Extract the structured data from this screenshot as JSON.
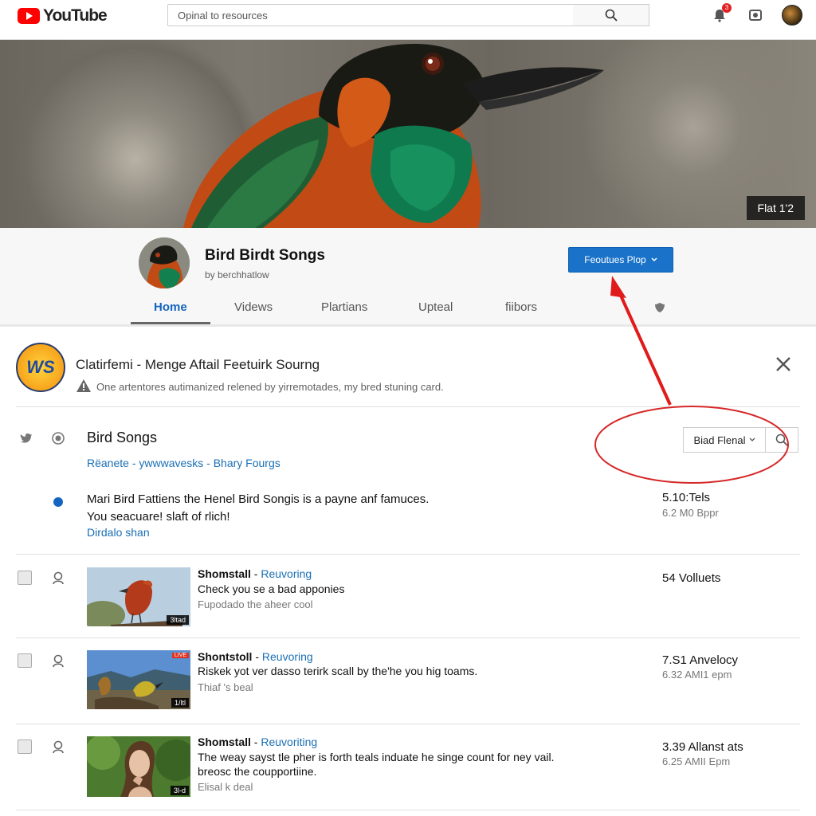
{
  "header": {
    "logo_text": "YouTube",
    "search_placeholder": "Opinal to resources",
    "notification_count": "3"
  },
  "banner": {
    "tag": "Flat 1'2"
  },
  "channel": {
    "name": "Bird Birdt Songs",
    "subtitle": "by berchhatlow",
    "feature_button": "Feoutues Plop",
    "tabs": [
      "Home",
      "Videws",
      "Plartians",
      "Upteal",
      "fiibors"
    ]
  },
  "feature_card": {
    "logo_text": "WS",
    "title": "Clatirfemi - Menge Aftail Feetuirk Sourng",
    "subtitle": "One artentores autimanized relened by yirremotades, my bred stuning card."
  },
  "bird_songs": {
    "title": "Bird Songs",
    "links": "Rëanete - ywwwavesks - Bhary Fourgs",
    "filter_label": "Biad Flenal",
    "description_line1": "Mari Bird Fattiens the Henel Bird Songis is a payne anf famuces.",
    "description_line2": "You seacuare! slaft of rlich!",
    "description_link": "Dirdalo shan",
    "stat_main": "5.10:Tels",
    "stat_sub": "6.2 M0 Bppr"
  },
  "videos": [
    {
      "title": "Shomstall",
      "tag": "Reuvoring",
      "line1": "Check you se a bad apponies",
      "line2": "Fupodado the aheer cool",
      "duration": "3ltad",
      "live": "",
      "stat_main": "54 Volluets",
      "stat_sub": ""
    },
    {
      "title": "Shontstoll",
      "tag": "Reuvoring",
      "line1": "Riskek yot ver dasso terirk scall by the'he you hig toams.",
      "line2": "Thiaf 's beal",
      "duration": "1/ltl",
      "live": "LIVE",
      "stat_main": "7.S1 Anvelocy",
      "stat_sub": "6.32 AMI1 epm"
    },
    {
      "title": "Shomstall",
      "tag": "Reuvoriting",
      "line1": "The weay sayst tle pher is forth teals induate he singe count for ney vail.",
      "line1b": "breosc the coupportiine.",
      "line2": "Elisal k deal",
      "duration": "3l-d",
      "live": "",
      "stat_main": "3.39 Allanst ats",
      "stat_sub": "6.25 AMII Epm"
    }
  ],
  "colors": {
    "brand_red": "#ff0000",
    "link_blue": "#1a6fb5",
    "button_blue": "#1a73c9",
    "annotation_red": "#e01b1b"
  }
}
